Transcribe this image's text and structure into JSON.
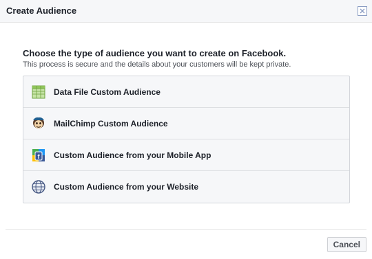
{
  "dialog": {
    "title": "Create Audience"
  },
  "intro": {
    "heading": "Choose the type of audience you want to create on Facebook.",
    "subtext": "This process is secure and the details about your customers will be kept private."
  },
  "options": [
    {
      "label": "Data File Custom Audience",
      "icon": "spreadsheet-icon"
    },
    {
      "label": "MailChimp Custom Audience",
      "icon": "mailchimp-icon"
    },
    {
      "label": "Custom Audience from your Mobile App",
      "icon": "mobile-app-icon"
    },
    {
      "label": "Custom Audience from your Website",
      "icon": "globe-icon"
    }
  ],
  "footer": {
    "cancel_label": "Cancel"
  },
  "colors": {
    "text": "#1d2129",
    "muted": "#4b4f56",
    "border": "#d3d6db",
    "row_bg": "#f6f7f9",
    "accent": "#4267b2"
  }
}
